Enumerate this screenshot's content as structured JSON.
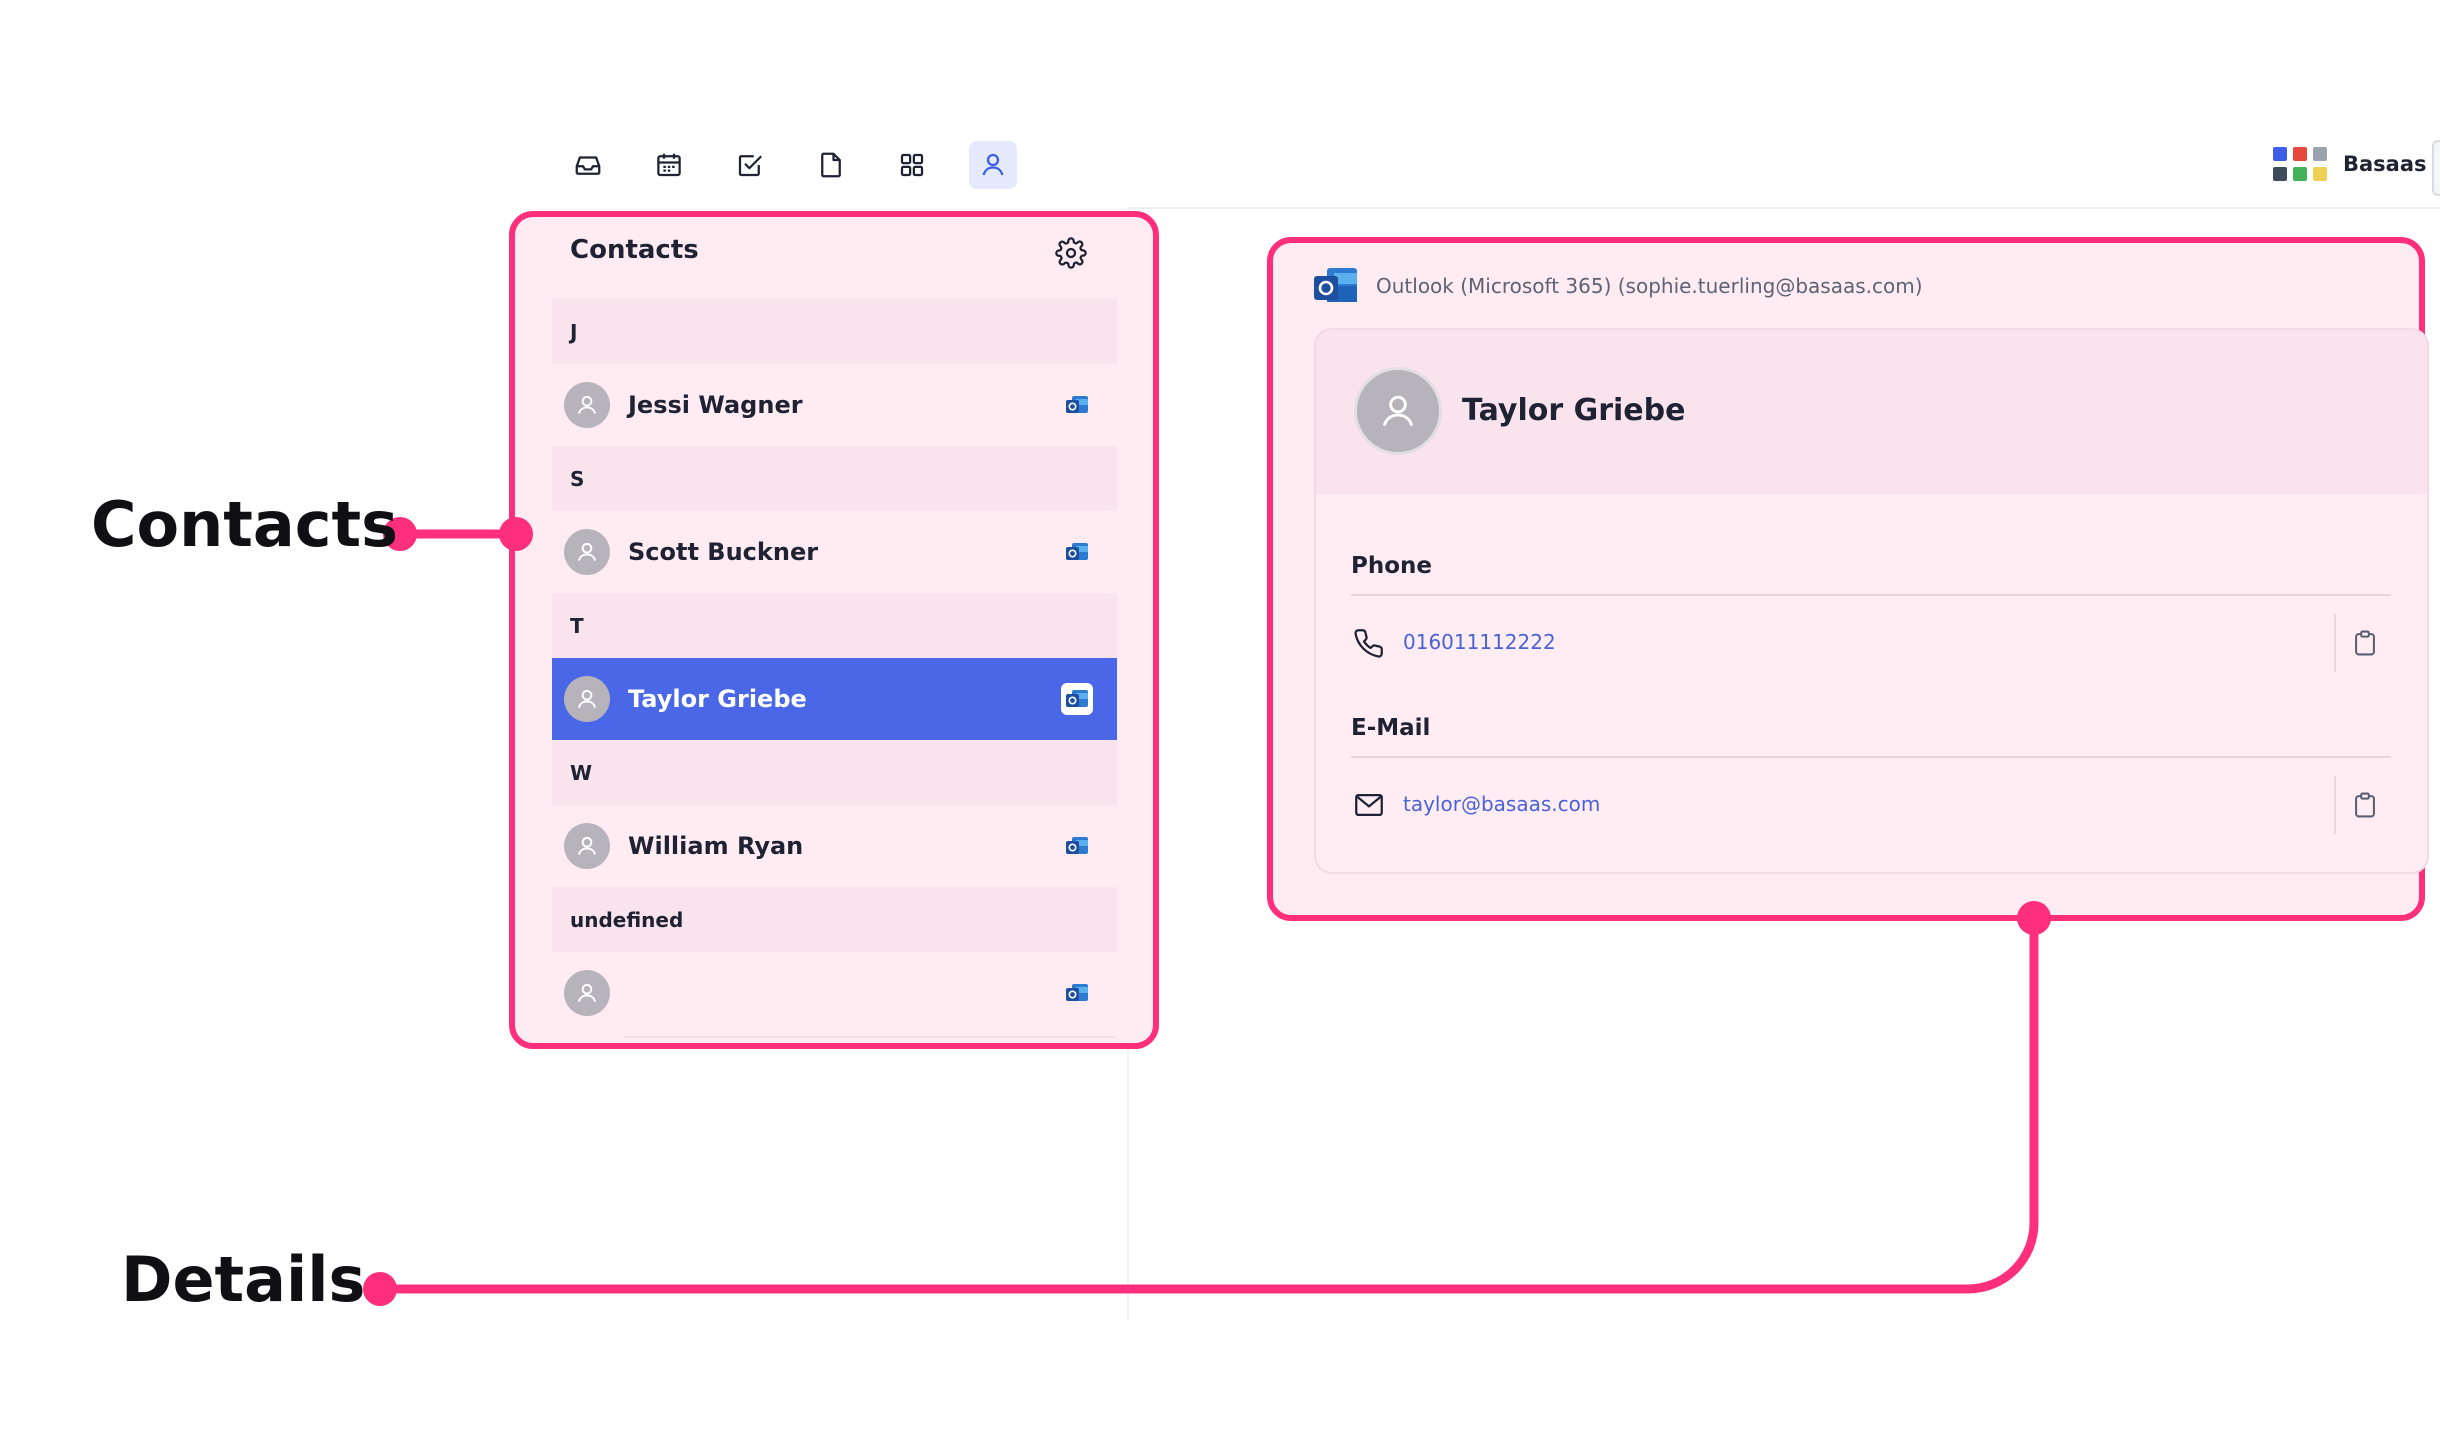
{
  "toolbar": {
    "icons": [
      "inbox-icon",
      "calendar-icon",
      "tasks-icon",
      "document-icon",
      "apps-grid-icon",
      "contacts-icon"
    ],
    "active": "contacts-icon"
  },
  "brand": {
    "label": "Basaas",
    "colors": [
      "#3b5de7",
      "#e8483b",
      "#9aa3ad",
      "#3f4a5a",
      "#44b05a",
      "#efd155"
    ]
  },
  "contacts": {
    "title": "Contacts",
    "groups": [
      {
        "letter": "J",
        "contacts": [
          {
            "name": "Jessi Wagner",
            "source": "outlook-icon"
          }
        ]
      },
      {
        "letter": "S",
        "contacts": [
          {
            "name": "Scott Buckner",
            "source": "outlook-icon"
          }
        ]
      },
      {
        "letter": "T",
        "contacts": [
          {
            "name": "Taylor Griebe",
            "source": "outlook-icon",
            "selected": true
          }
        ]
      },
      {
        "letter": "W",
        "contacts": [
          {
            "name": "William Ryan",
            "source": "outlook-icon"
          }
        ]
      },
      {
        "letter": "undefined",
        "contacts": [
          {
            "name": "",
            "source": "outlook-icon"
          }
        ]
      }
    ]
  },
  "details": {
    "source": "Outlook (Microsoft 365) (sophie.tuerling@basaas.com)",
    "name": "Taylor Griebe",
    "phone_label": "Phone",
    "phone": "016011112222",
    "email_label": "E-Mail",
    "email": "taylor@basaas.com"
  },
  "annotations": {
    "contacts_label": "Contacts",
    "details_label": "Details",
    "color": "#ff2f7c"
  }
}
